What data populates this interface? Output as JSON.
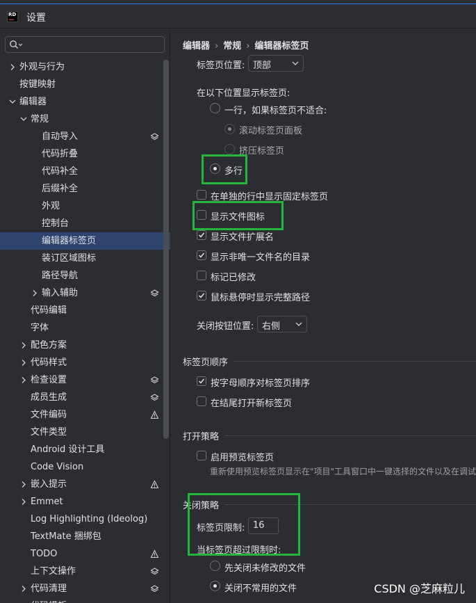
{
  "window": {
    "title": "设置",
    "logo_text": "RD"
  },
  "search": {
    "placeholder": ""
  },
  "sidebar": {
    "items": [
      {
        "label": "外观与行为",
        "level": 0,
        "chevron": "right"
      },
      {
        "label": "按键映射",
        "level": 0,
        "chevron": ""
      },
      {
        "label": "编辑器",
        "level": 0,
        "chevron": "down"
      },
      {
        "label": "常规",
        "level": 1,
        "chevron": "down"
      },
      {
        "label": "自动导入",
        "level": 2,
        "chevron": "",
        "icon": "layers-icon"
      },
      {
        "label": "代码折叠",
        "level": 2,
        "chevron": ""
      },
      {
        "label": "代码补全",
        "level": 2,
        "chevron": ""
      },
      {
        "label": "后缀补全",
        "level": 2,
        "chevron": ""
      },
      {
        "label": "外观",
        "level": 2,
        "chevron": ""
      },
      {
        "label": "控制台",
        "level": 2,
        "chevron": ""
      },
      {
        "label": "编辑器标签页",
        "level": 2,
        "chevron": "",
        "selected": true
      },
      {
        "label": "装订区域图标",
        "level": 2,
        "chevron": ""
      },
      {
        "label": "路径导航",
        "level": 2,
        "chevron": ""
      },
      {
        "label": "输入辅助",
        "level": 2,
        "chevron": "right",
        "icon": "layers-icon"
      },
      {
        "label": "代码编辑",
        "level": 1,
        "chevron": ""
      },
      {
        "label": "字体",
        "level": 1,
        "chevron": ""
      },
      {
        "label": "配色方案",
        "level": 1,
        "chevron": "right"
      },
      {
        "label": "代码样式",
        "level": 1,
        "chevron": "right"
      },
      {
        "label": "检查设置",
        "level": 1,
        "chevron": "right",
        "icon": "layers-icon"
      },
      {
        "label": "成员生成",
        "level": 1,
        "chevron": "",
        "icon": "layers-icon"
      },
      {
        "label": "文件编码",
        "level": 1,
        "chevron": "",
        "icon": "warning-icon"
      },
      {
        "label": "文件类型",
        "level": 1,
        "chevron": ""
      },
      {
        "label": "Android 设计工具",
        "level": 1,
        "chevron": ""
      },
      {
        "label": "Code Vision",
        "level": 1,
        "chevron": ""
      },
      {
        "label": "嵌入提示",
        "level": 1,
        "chevron": "right",
        "icon": "warning-icon"
      },
      {
        "label": "Emmet",
        "level": 1,
        "chevron": "right"
      },
      {
        "label": "Log Highlighting (Ideolog)",
        "level": 1,
        "chevron": ""
      },
      {
        "label": "TextMate 捆绑包",
        "level": 1,
        "chevron": ""
      },
      {
        "label": "TODO",
        "level": 1,
        "chevron": "",
        "icon": "warning-icon"
      },
      {
        "label": "上下文操作",
        "level": 1,
        "chevron": "",
        "icon": "layers-icon"
      },
      {
        "label": "代码清理",
        "level": 1,
        "chevron": "right",
        "icon": "layers-icon"
      },
      {
        "label": "代码模板",
        "level": 1,
        "chevron": "right"
      }
    ]
  },
  "breadcrumb": {
    "part1": "编辑器",
    "part2": "常规",
    "part3": "编辑器标签页",
    "sep": "›"
  },
  "main": {
    "tab_placement_label": "标签页位置:",
    "tab_placement_value": "顶部",
    "show_tabs_in_label": "在以下位置显示标签页:",
    "one_row_label": "一行，如果标签页不适合:",
    "scroll_panel_label": "滚动标签页面板",
    "squeeze_label": "挤压标签页",
    "multi_row_label": "多行",
    "pinned_separate_row_label": "在单独的行中显示固定标签页",
    "show_file_icon_label": "显示文件图标",
    "show_file_ext_label": "显示文件扩展名",
    "show_dir_nonunique_label": "显示非唯一文件名的目录",
    "mark_modified_label": "标记已修改",
    "full_path_hover_label": "鼠标悬停时显示完整路径",
    "close_button_pos_label": "关闭按钮位置:",
    "close_button_pos_value": "右侧",
    "tab_order_section": "标签页顺序",
    "sort_alpha_label": "按字母顺序对标签页排序",
    "open_at_end_label": "在结尾打开新标签页",
    "open_policy_section": "打开策略",
    "enable_preview_label": "启用预览标签页",
    "enable_preview_desc": "重新使用预览标签页显示在\"项目\"工具窗口中一键选择的文件以及在调试",
    "close_policy_section": "关闭策略",
    "tab_limit_label": "标签页限制:",
    "tab_limit_value": "16",
    "when_exceeds_label": "当标签页超过限制时:",
    "close_unmodified_label": "先关闭未修改的文件",
    "close_unused_label": "关闭不常用的文件"
  },
  "state": {
    "multi_row_selected": true,
    "show_file_icon": false,
    "show_file_ext": true,
    "show_dir_nonunique": true,
    "mark_modified": false,
    "full_path_hover": true,
    "sort_alpha": true,
    "open_at_end": false,
    "enable_preview": false,
    "pinned_separate_row": false
  },
  "colors": {
    "highlight": "#22b63a",
    "selection": "#2e436e",
    "accent": "#3574f0"
  },
  "watermark": "CSDN @芝麻粒儿"
}
